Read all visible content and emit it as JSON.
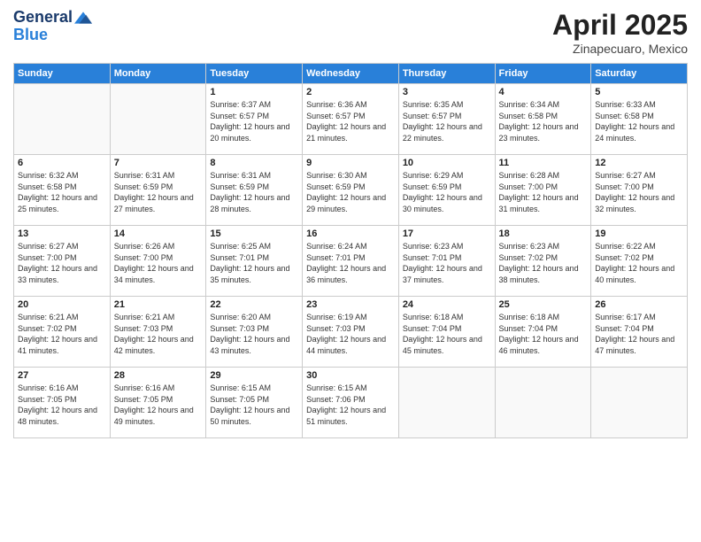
{
  "header": {
    "logo_line1": "General",
    "logo_line2": "Blue",
    "month_title": "April 2025",
    "subtitle": "Zinapecuaro, Mexico"
  },
  "weekdays": [
    "Sunday",
    "Monday",
    "Tuesday",
    "Wednesday",
    "Thursday",
    "Friday",
    "Saturday"
  ],
  "days": [
    {
      "num": "",
      "info": ""
    },
    {
      "num": "",
      "info": ""
    },
    {
      "num": "1",
      "info": "Sunrise: 6:37 AM\nSunset: 6:57 PM\nDaylight: 12 hours and 20 minutes."
    },
    {
      "num": "2",
      "info": "Sunrise: 6:36 AM\nSunset: 6:57 PM\nDaylight: 12 hours and 21 minutes."
    },
    {
      "num": "3",
      "info": "Sunrise: 6:35 AM\nSunset: 6:57 PM\nDaylight: 12 hours and 22 minutes."
    },
    {
      "num": "4",
      "info": "Sunrise: 6:34 AM\nSunset: 6:58 PM\nDaylight: 12 hours and 23 minutes."
    },
    {
      "num": "5",
      "info": "Sunrise: 6:33 AM\nSunset: 6:58 PM\nDaylight: 12 hours and 24 minutes."
    },
    {
      "num": "6",
      "info": "Sunrise: 6:32 AM\nSunset: 6:58 PM\nDaylight: 12 hours and 25 minutes."
    },
    {
      "num": "7",
      "info": "Sunrise: 6:31 AM\nSunset: 6:59 PM\nDaylight: 12 hours and 27 minutes."
    },
    {
      "num": "8",
      "info": "Sunrise: 6:31 AM\nSunset: 6:59 PM\nDaylight: 12 hours and 28 minutes."
    },
    {
      "num": "9",
      "info": "Sunrise: 6:30 AM\nSunset: 6:59 PM\nDaylight: 12 hours and 29 minutes."
    },
    {
      "num": "10",
      "info": "Sunrise: 6:29 AM\nSunset: 6:59 PM\nDaylight: 12 hours and 30 minutes."
    },
    {
      "num": "11",
      "info": "Sunrise: 6:28 AM\nSunset: 7:00 PM\nDaylight: 12 hours and 31 minutes."
    },
    {
      "num": "12",
      "info": "Sunrise: 6:27 AM\nSunset: 7:00 PM\nDaylight: 12 hours and 32 minutes."
    },
    {
      "num": "13",
      "info": "Sunrise: 6:27 AM\nSunset: 7:00 PM\nDaylight: 12 hours and 33 minutes."
    },
    {
      "num": "14",
      "info": "Sunrise: 6:26 AM\nSunset: 7:00 PM\nDaylight: 12 hours and 34 minutes."
    },
    {
      "num": "15",
      "info": "Sunrise: 6:25 AM\nSunset: 7:01 PM\nDaylight: 12 hours and 35 minutes."
    },
    {
      "num": "16",
      "info": "Sunrise: 6:24 AM\nSunset: 7:01 PM\nDaylight: 12 hours and 36 minutes."
    },
    {
      "num": "17",
      "info": "Sunrise: 6:23 AM\nSunset: 7:01 PM\nDaylight: 12 hours and 37 minutes."
    },
    {
      "num": "18",
      "info": "Sunrise: 6:23 AM\nSunset: 7:02 PM\nDaylight: 12 hours and 38 minutes."
    },
    {
      "num": "19",
      "info": "Sunrise: 6:22 AM\nSunset: 7:02 PM\nDaylight: 12 hours and 40 minutes."
    },
    {
      "num": "20",
      "info": "Sunrise: 6:21 AM\nSunset: 7:02 PM\nDaylight: 12 hours and 41 minutes."
    },
    {
      "num": "21",
      "info": "Sunrise: 6:21 AM\nSunset: 7:03 PM\nDaylight: 12 hours and 42 minutes."
    },
    {
      "num": "22",
      "info": "Sunrise: 6:20 AM\nSunset: 7:03 PM\nDaylight: 12 hours and 43 minutes."
    },
    {
      "num": "23",
      "info": "Sunrise: 6:19 AM\nSunset: 7:03 PM\nDaylight: 12 hours and 44 minutes."
    },
    {
      "num": "24",
      "info": "Sunrise: 6:18 AM\nSunset: 7:04 PM\nDaylight: 12 hours and 45 minutes."
    },
    {
      "num": "25",
      "info": "Sunrise: 6:18 AM\nSunset: 7:04 PM\nDaylight: 12 hours and 46 minutes."
    },
    {
      "num": "26",
      "info": "Sunrise: 6:17 AM\nSunset: 7:04 PM\nDaylight: 12 hours and 47 minutes."
    },
    {
      "num": "27",
      "info": "Sunrise: 6:16 AM\nSunset: 7:05 PM\nDaylight: 12 hours and 48 minutes."
    },
    {
      "num": "28",
      "info": "Sunrise: 6:16 AM\nSunset: 7:05 PM\nDaylight: 12 hours and 49 minutes."
    },
    {
      "num": "29",
      "info": "Sunrise: 6:15 AM\nSunset: 7:05 PM\nDaylight: 12 hours and 50 minutes."
    },
    {
      "num": "30",
      "info": "Sunrise: 6:15 AM\nSunset: 7:06 PM\nDaylight: 12 hours and 51 minutes."
    },
    {
      "num": "",
      "info": ""
    },
    {
      "num": "",
      "info": ""
    },
    {
      "num": "",
      "info": ""
    },
    {
      "num": "",
      "info": ""
    }
  ]
}
